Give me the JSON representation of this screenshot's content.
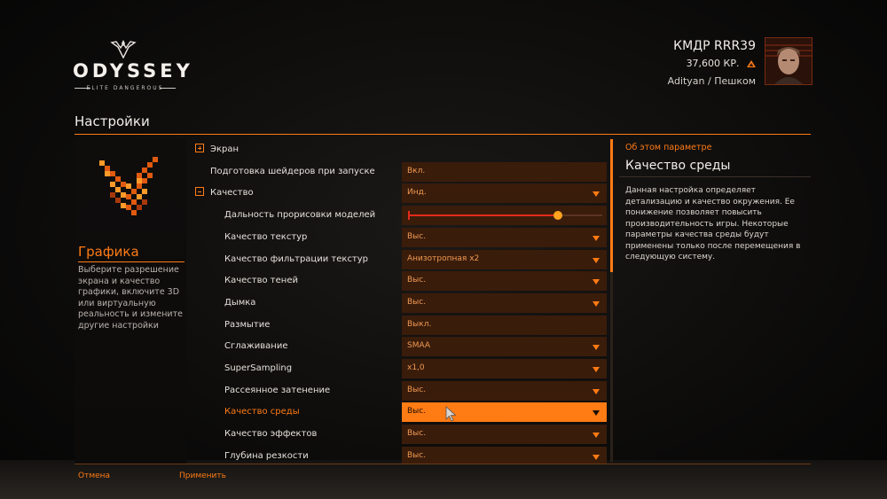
{
  "brand": {
    "title": "ODYSSEY",
    "subtitle": "ELITE DANGEROUS"
  },
  "commander": {
    "name": "КМДР RRR39",
    "credits": "37,600 КР.",
    "location": "Adityan / Пешком"
  },
  "page": {
    "title": "Настройки"
  },
  "category": {
    "title": "Графика",
    "description": "Выберите разрешение экрана и качество графики, включите 3D или виртуальную реальность и измените другие настройки"
  },
  "settings": [
    {
      "label": "Экран",
      "type": "group",
      "expanded": false
    },
    {
      "label": "Подготовка шейдеров при запуске",
      "type": "toggle",
      "value": "Вкл."
    },
    {
      "label": "Качество",
      "type": "group-select",
      "expanded": true,
      "value": "Инд."
    },
    {
      "label": "Дальность прорисовки моделей",
      "type": "slider",
      "level": 0.77
    },
    {
      "label": "Качество текстур",
      "type": "select",
      "value": "Выс."
    },
    {
      "label": "Качество фильтрации текстур",
      "type": "select",
      "value": "Анизотропная x2"
    },
    {
      "label": "Качество теней",
      "type": "select",
      "value": "Выс."
    },
    {
      "label": "Дымка",
      "type": "select",
      "value": "Выс."
    },
    {
      "label": "Размытие",
      "type": "toggle",
      "value": "Выкл."
    },
    {
      "label": "Сглаживание",
      "type": "select",
      "value": "SMAA"
    },
    {
      "label": "SuperSampling",
      "type": "select",
      "value": "x1,0"
    },
    {
      "label": "Рассеянное затенение",
      "type": "select",
      "value": "Выс."
    },
    {
      "label": "Качество среды",
      "type": "select",
      "value": "Выс.",
      "active": true
    },
    {
      "label": "Качество эффектов",
      "type": "select",
      "value": "Выс."
    },
    {
      "label": "Глубина резкости",
      "type": "select",
      "value": "Выс."
    }
  ],
  "info": {
    "caption": "Об этом параметре",
    "title": "Качество среды",
    "text": "Данная настройка определяет детализацию и качество окружения. Ее понижение позволяет повысить производительность игры. Некоторые параметры качества среды будут применены только после перемещения в следующую систему."
  },
  "footer": {
    "cancel": "Отмена",
    "apply": "Применить"
  },
  "colors": {
    "accent": "#ff7b14",
    "field_bg": "#3a1c0b",
    "slider_fill": "#e42a1a"
  },
  "icons": {
    "logo": "elite-wings-icon",
    "credits": "credits-icon",
    "category": "graphics-wings-icon",
    "expand": "plus-square-icon",
    "collapse": "minus-square-icon",
    "dropdown": "caret-down-icon"
  }
}
